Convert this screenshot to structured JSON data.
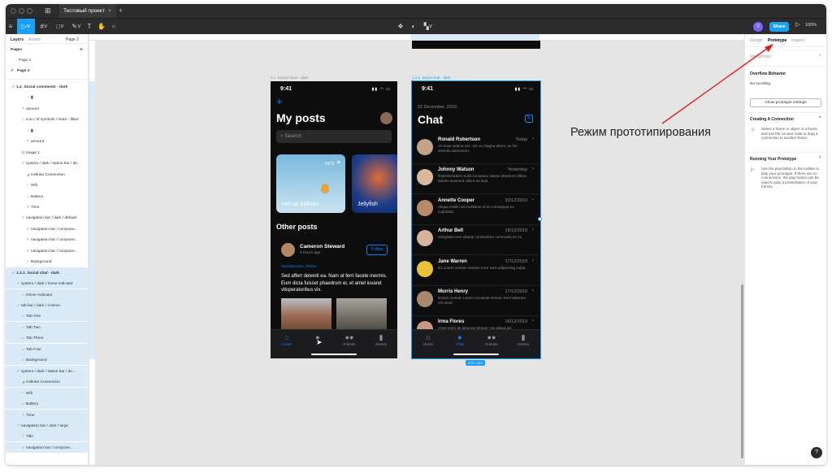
{
  "titlebar": {
    "file_tab": "Тестовый проект",
    "close": "×",
    "new_tab": "+"
  },
  "toolbar": {
    "avatar": "V",
    "share": "Share",
    "zoom": "100%"
  },
  "layers_panel": {
    "tabs": [
      "Layers",
      "Assets"
    ],
    "page_selector": "Page 2",
    "pages_label": "Pages",
    "pages": [
      "Page 1",
      "Page 2"
    ],
    "current_page_check": "✓",
    "items": [
      "1.2. Social comments - dark",
      "",
      "amount",
      "icon / sf symbols / heart - filled",
      "",
      "amount",
      "image 1",
      "system / dark / status bar / de...",
      "Cellular Connection",
      "Wifi",
      "Battery",
      "Time",
      "navigation bar / dark / default",
      "navigation bar / compone...",
      "navigation bar / compone...",
      "navigation bar / compone...",
      "Background",
      "1.3.1. Social chat - dark",
      "system / dark / home indicator",
      "Home Indicator",
      "tab bar / dark / 4 items",
      "Tab One",
      "Tab Two",
      "Tab Three",
      "Tab Four",
      "Background",
      "system / dark / status bar / de...",
      "Cellular Connection",
      "Wifi",
      "Battery",
      "Time",
      "navigation bar / dark / large",
      "Title",
      "navigation bar / compone..."
    ]
  },
  "canvas": {
    "frame1_label": "1.1. Social home - dark",
    "frame2_label": "1.3.1. Social chat - dark",
    "size_badge": "375 × 812"
  },
  "phone1": {
    "time": "9:41",
    "plus": "+",
    "title": "My posts",
    "search_placeholder": "Search",
    "cards": [
      {
        "label": "Hot air balloon",
        "count": "6473"
      },
      {
        "label": "Jellyfish"
      }
    ],
    "section": "Other posts",
    "post_author": "Cameron Steward",
    "post_time": "3 hours ago",
    "follow": "Follow",
    "tags": "#architecture, #relax",
    "post_text": "Sed affert deleniti ea. Nam at ferri facete inermis. Eum dicta fuisset phaedrum ei, et amet iuvaret vituperatoribus vix.",
    "tabs": [
      "Home",
      "",
      "Friends",
      "Stories"
    ]
  },
  "phone2": {
    "time": "9:41",
    "date": "22 December, 2019",
    "title": "Chat",
    "chats": [
      {
        "name": "Ronald Robertson",
        "date": "Today",
        "msg": "An suas viderer pro. Vis cu magna altera, ex his vivendo atomorum."
      },
      {
        "name": "Johnny Watson",
        "date": "Yesterday",
        "msg": "Reprehenderit mollit excepteur labore deserunt officia laboris eiusmod cillum eu duis."
      },
      {
        "name": "Annette Cooper",
        "date": "20/12/2019",
        "msg": "Aliqua mollit nisi incididunt id eu consequat eu cupidatat."
      },
      {
        "name": "Arthur Bell",
        "date": "18/12/2019",
        "msg": "Voluptate irure aliquip consectetur commodo ex ex."
      },
      {
        "name": "Jane Warren",
        "date": "17/12/2019",
        "msg": "Ex Lorem veniam veniam irure sunt adipisicing culpa."
      },
      {
        "name": "Morris Henry",
        "date": "17/12/2019",
        "msg": "Dolore veniam Lorem occaecat veniam irure laborum est amet."
      },
      {
        "name": "Irma Flores",
        "date": "16/12/2019",
        "msg": "Amet enim do laborum tempor nisi aliqua ad adipisicing."
      }
    ],
    "tabs": [
      "Home",
      "Chat",
      "Friends",
      "Stories"
    ]
  },
  "props_panel": {
    "tabs": [
      "Design",
      "Prototype",
      "Inspect"
    ],
    "interactions": "Interactions",
    "overflow_title": "Overflow Behavior",
    "overflow_value": "No scrolling",
    "settings_btn": "Show prototype settings",
    "creating_title": "Creating A Connection",
    "creating_text": "Select a frame or object in a frame and use the circular node to drag a connection to another frame.",
    "running_title": "Running Your Prototype",
    "running_text": "Use the play button in the toolbar to play your prototype. If there are no connections, the play button can be used to play a presentation of your frames."
  },
  "help": "?",
  "annotation": "Режим прототипирования",
  "colors": {
    "accent": "#18a0fb",
    "ios_blue": "#0a84ff",
    "arrow": "#e02020"
  }
}
